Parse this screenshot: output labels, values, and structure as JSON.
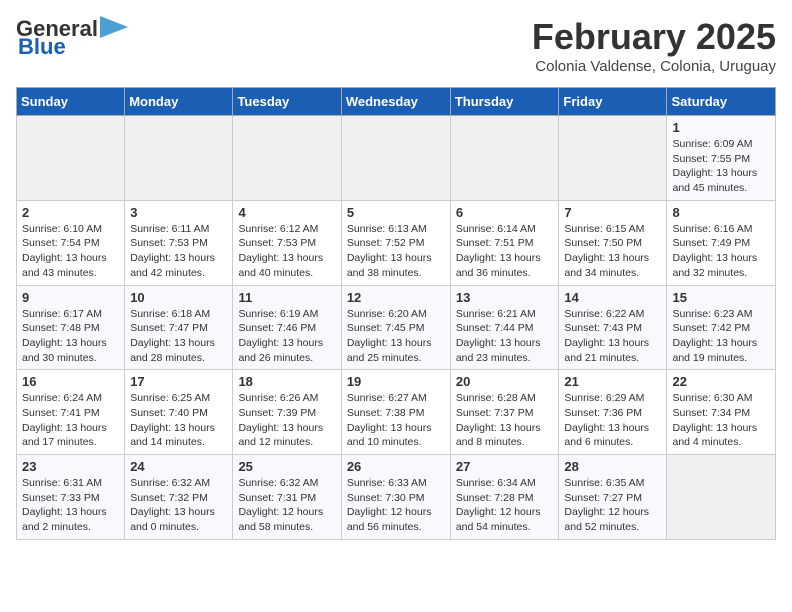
{
  "header": {
    "logo_general": "General",
    "logo_blue": "Blue",
    "month_title": "February 2025",
    "subtitle": "Colonia Valdense, Colonia, Uruguay"
  },
  "days_of_week": [
    "Sunday",
    "Monday",
    "Tuesday",
    "Wednesday",
    "Thursday",
    "Friday",
    "Saturday"
  ],
  "weeks": [
    [
      {
        "day": "",
        "info": ""
      },
      {
        "day": "",
        "info": ""
      },
      {
        "day": "",
        "info": ""
      },
      {
        "day": "",
        "info": ""
      },
      {
        "day": "",
        "info": ""
      },
      {
        "day": "",
        "info": ""
      },
      {
        "day": "1",
        "info": "Sunrise: 6:09 AM\nSunset: 7:55 PM\nDaylight: 13 hours\nand 45 minutes."
      }
    ],
    [
      {
        "day": "2",
        "info": "Sunrise: 6:10 AM\nSunset: 7:54 PM\nDaylight: 13 hours\nand 43 minutes."
      },
      {
        "day": "3",
        "info": "Sunrise: 6:11 AM\nSunset: 7:53 PM\nDaylight: 13 hours\nand 42 minutes."
      },
      {
        "day": "4",
        "info": "Sunrise: 6:12 AM\nSunset: 7:53 PM\nDaylight: 13 hours\nand 40 minutes."
      },
      {
        "day": "5",
        "info": "Sunrise: 6:13 AM\nSunset: 7:52 PM\nDaylight: 13 hours\nand 38 minutes."
      },
      {
        "day": "6",
        "info": "Sunrise: 6:14 AM\nSunset: 7:51 PM\nDaylight: 13 hours\nand 36 minutes."
      },
      {
        "day": "7",
        "info": "Sunrise: 6:15 AM\nSunset: 7:50 PM\nDaylight: 13 hours\nand 34 minutes."
      },
      {
        "day": "8",
        "info": "Sunrise: 6:16 AM\nSunset: 7:49 PM\nDaylight: 13 hours\nand 32 minutes."
      }
    ],
    [
      {
        "day": "9",
        "info": "Sunrise: 6:17 AM\nSunset: 7:48 PM\nDaylight: 13 hours\nand 30 minutes."
      },
      {
        "day": "10",
        "info": "Sunrise: 6:18 AM\nSunset: 7:47 PM\nDaylight: 13 hours\nand 28 minutes."
      },
      {
        "day": "11",
        "info": "Sunrise: 6:19 AM\nSunset: 7:46 PM\nDaylight: 13 hours\nand 26 minutes."
      },
      {
        "day": "12",
        "info": "Sunrise: 6:20 AM\nSunset: 7:45 PM\nDaylight: 13 hours\nand 25 minutes."
      },
      {
        "day": "13",
        "info": "Sunrise: 6:21 AM\nSunset: 7:44 PM\nDaylight: 13 hours\nand 23 minutes."
      },
      {
        "day": "14",
        "info": "Sunrise: 6:22 AM\nSunset: 7:43 PM\nDaylight: 13 hours\nand 21 minutes."
      },
      {
        "day": "15",
        "info": "Sunrise: 6:23 AM\nSunset: 7:42 PM\nDaylight: 13 hours\nand 19 minutes."
      }
    ],
    [
      {
        "day": "16",
        "info": "Sunrise: 6:24 AM\nSunset: 7:41 PM\nDaylight: 13 hours\nand 17 minutes."
      },
      {
        "day": "17",
        "info": "Sunrise: 6:25 AM\nSunset: 7:40 PM\nDaylight: 13 hours\nand 14 minutes."
      },
      {
        "day": "18",
        "info": "Sunrise: 6:26 AM\nSunset: 7:39 PM\nDaylight: 13 hours\nand 12 minutes."
      },
      {
        "day": "19",
        "info": "Sunrise: 6:27 AM\nSunset: 7:38 PM\nDaylight: 13 hours\nand 10 minutes."
      },
      {
        "day": "20",
        "info": "Sunrise: 6:28 AM\nSunset: 7:37 PM\nDaylight: 13 hours\nand 8 minutes."
      },
      {
        "day": "21",
        "info": "Sunrise: 6:29 AM\nSunset: 7:36 PM\nDaylight: 13 hours\nand 6 minutes."
      },
      {
        "day": "22",
        "info": "Sunrise: 6:30 AM\nSunset: 7:34 PM\nDaylight: 13 hours\nand 4 minutes."
      }
    ],
    [
      {
        "day": "23",
        "info": "Sunrise: 6:31 AM\nSunset: 7:33 PM\nDaylight: 13 hours\nand 2 minutes."
      },
      {
        "day": "24",
        "info": "Sunrise: 6:32 AM\nSunset: 7:32 PM\nDaylight: 13 hours\nand 0 minutes."
      },
      {
        "day": "25",
        "info": "Sunrise: 6:32 AM\nSunset: 7:31 PM\nDaylight: 12 hours\nand 58 minutes."
      },
      {
        "day": "26",
        "info": "Sunrise: 6:33 AM\nSunset: 7:30 PM\nDaylight: 12 hours\nand 56 minutes."
      },
      {
        "day": "27",
        "info": "Sunrise: 6:34 AM\nSunset: 7:28 PM\nDaylight: 12 hours\nand 54 minutes."
      },
      {
        "day": "28",
        "info": "Sunrise: 6:35 AM\nSunset: 7:27 PM\nDaylight: 12 hours\nand 52 minutes."
      },
      {
        "day": "",
        "info": ""
      }
    ]
  ]
}
